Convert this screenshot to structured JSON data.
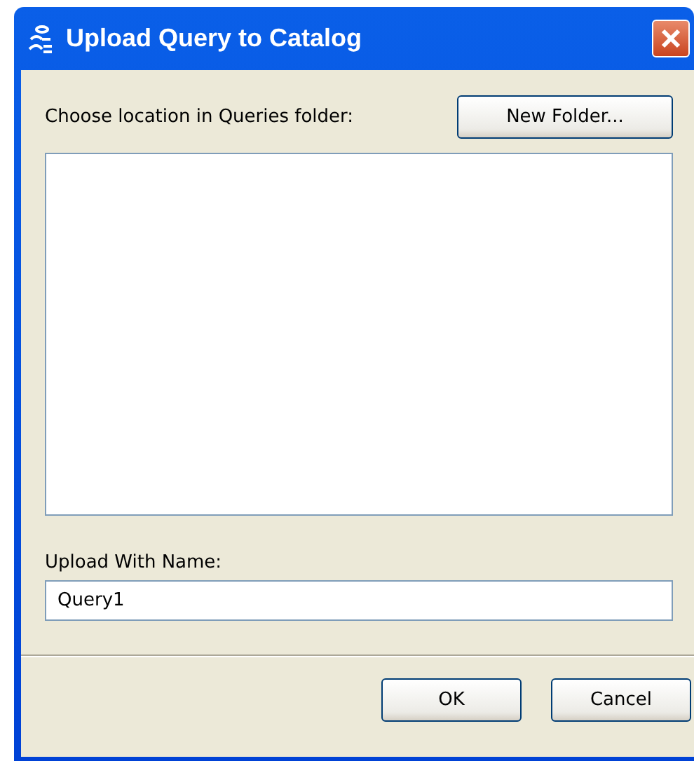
{
  "window": {
    "title": "Upload Query to Catalog"
  },
  "location_label": "Choose location in Queries folder:",
  "new_folder_button": "New Folder...",
  "name_label": "Upload With Name:",
  "name_field": {
    "value": "Query1"
  },
  "buttons": [
    "OK",
    "Cancel"
  ]
}
